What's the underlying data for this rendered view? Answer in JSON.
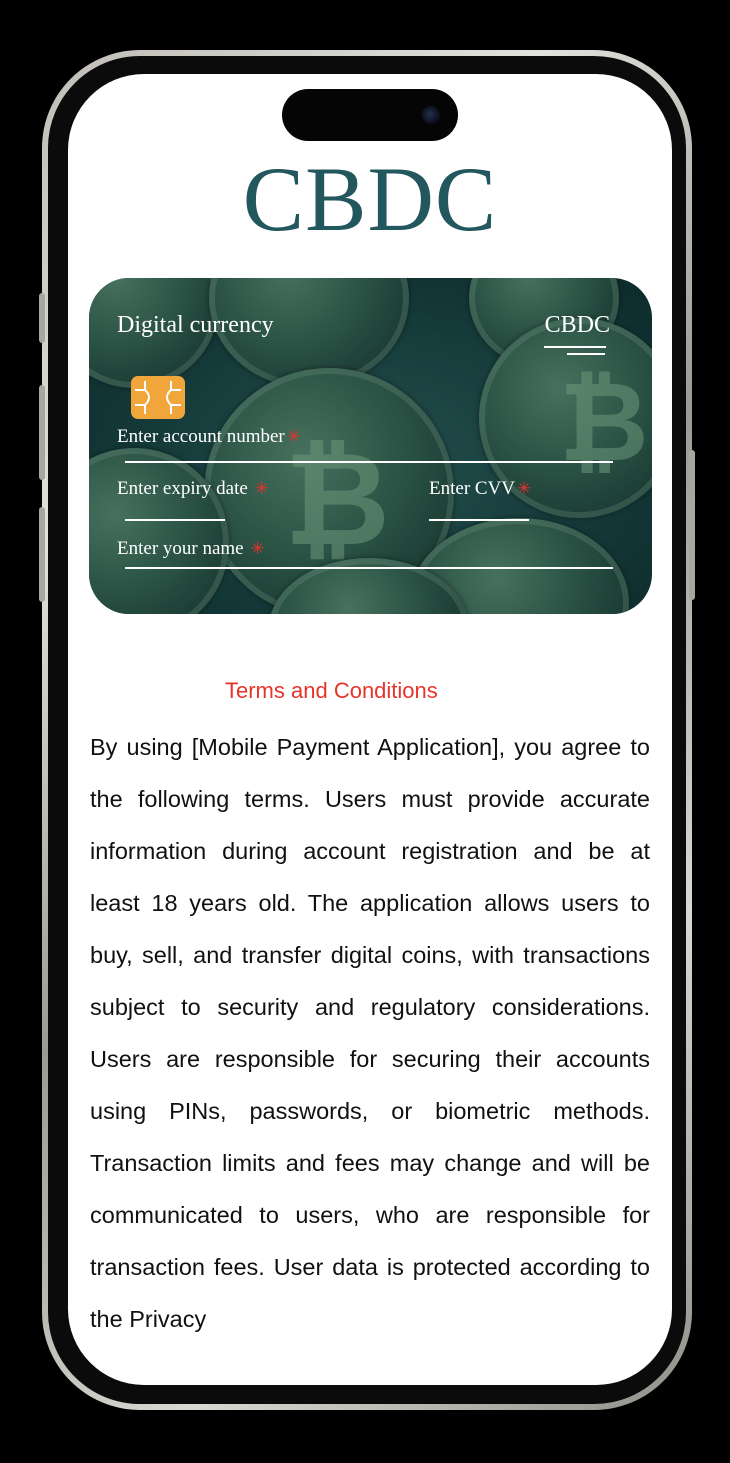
{
  "app": {
    "title": "CBDC"
  },
  "card": {
    "label_left": "Digital currency",
    "brand": "CBDC",
    "fields": {
      "account_number": "Enter account number",
      "expiry_date": "Enter expiry date",
      "cvv": "Enter CVV",
      "name": "Enter your name"
    },
    "required_mark": "✳"
  },
  "terms": {
    "heading": "Terms and Conditions",
    "body": "By using [Mobile Payment Application], you agree to the following terms. Users must provide accurate information during account registration and be at least 18 years old. The application allows users to buy, sell, and transfer digital coins, with transactions subject to security and regulatory considerations. Users are responsible for securing their accounts using PINs, passwords, or biometric methods. Transaction limits and fees may change and will be communicated to users, who are responsible for transaction fees. User data is protected according to the Privacy"
  },
  "icons": {
    "chip": "card-chip-icon",
    "background": "crypto-coins-image"
  },
  "colors": {
    "title": "#21575d",
    "heading": "#e5352b",
    "required": "#e8322c",
    "chip": "#f0a63a"
  }
}
